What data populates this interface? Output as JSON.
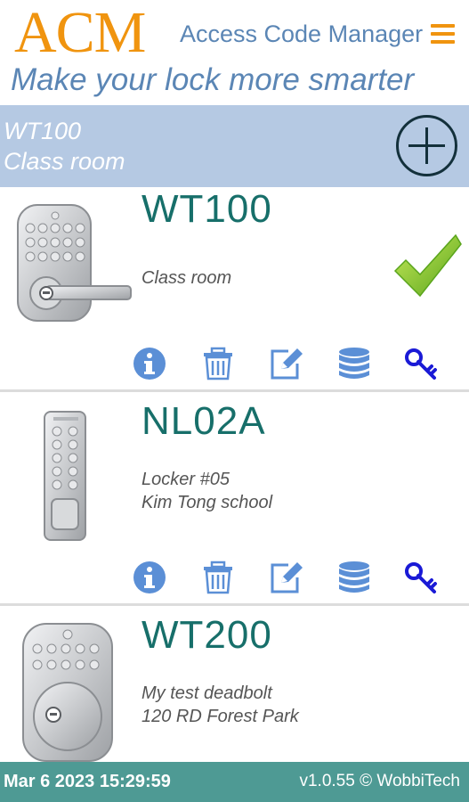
{
  "header": {
    "logo": "ACM",
    "title": "Access Code Manager",
    "tagline": "Make your lock more smarter",
    "menu_icon": "hamburger-menu-icon"
  },
  "selected": {
    "code": "WT100",
    "name": "Class room",
    "add_icon": "plus-circle-icon"
  },
  "devices": [
    {
      "code": "WT100",
      "lines": [
        "Class room"
      ],
      "image": "lever-lock-image",
      "selected": true,
      "status_icon": "green-checkmark-icon",
      "actions": [
        "info-icon",
        "trash-icon",
        "edit-icon",
        "database-icon",
        "key-icon"
      ]
    },
    {
      "code": "NL02A",
      "lines": [
        "Locker #05",
        "Kim Tong school"
      ],
      "image": "keypad-locker-image",
      "actions": [
        "info-icon",
        "trash-icon",
        "edit-icon",
        "database-icon",
        "key-icon"
      ]
    },
    {
      "code": "WT200",
      "lines": [
        "My test deadbolt",
        "120 RD Forest Park"
      ],
      "image": "deadbolt-lock-image"
    }
  ],
  "footer": {
    "datetime": "Mar 6 2023 15:29:59",
    "version": "v1.0.55 © WobbiTech"
  },
  "colors": {
    "accent_orange": "#f0940f",
    "title_blue": "#5b86b5",
    "selection_bar": "#b5c9e3",
    "device_code": "#176f6a",
    "icon_blue": "#5b8fd6",
    "footer": "#4e9a94",
    "check_green": "#7cc01f"
  }
}
